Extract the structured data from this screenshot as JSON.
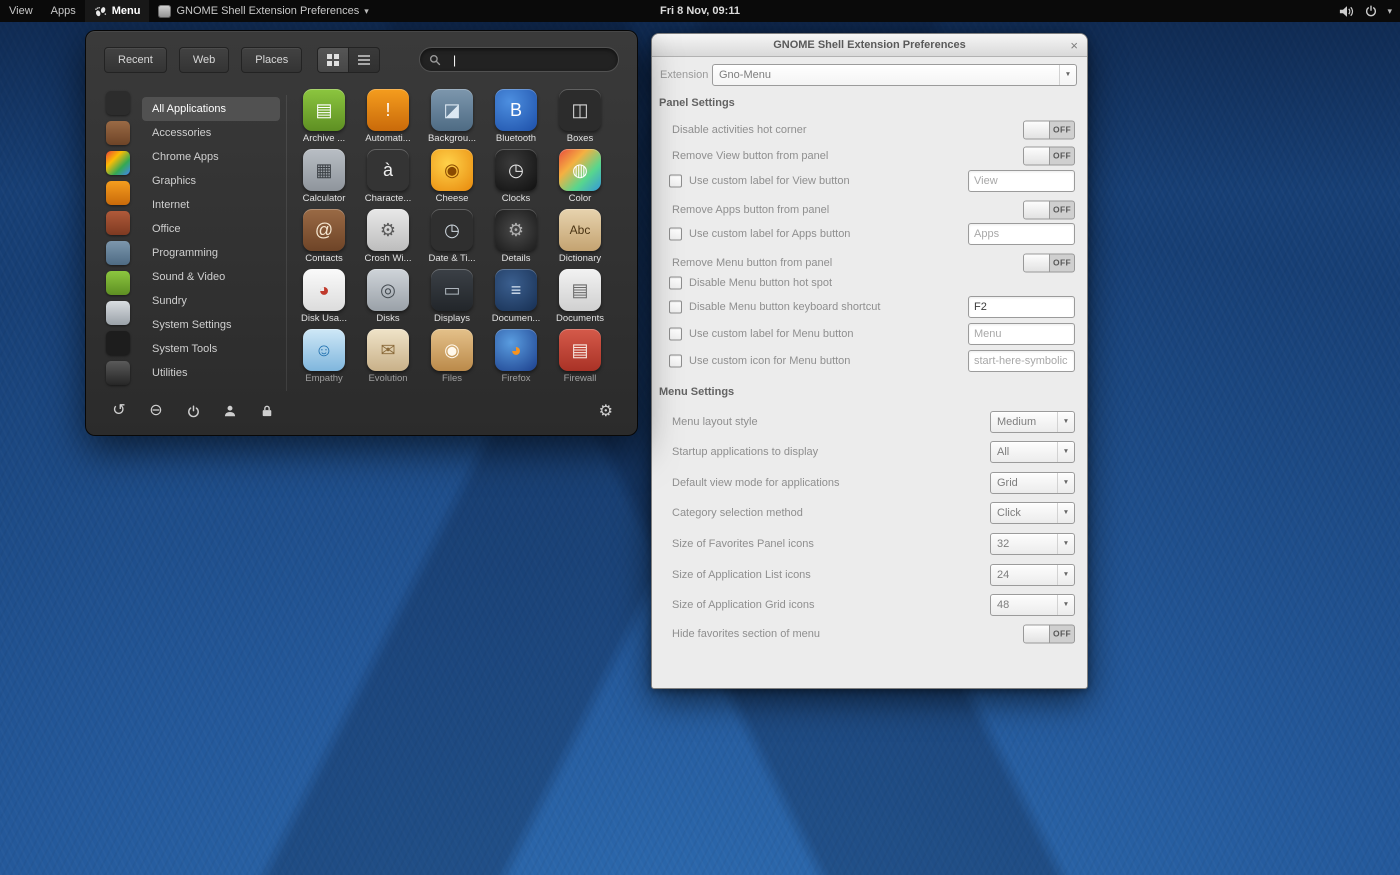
{
  "topbar": {
    "view_button": "View",
    "apps_button": "Apps",
    "menu_button": "Menu",
    "app_menu_label": "GNOME Shell Extension Preferences",
    "clock": "Fri 8 Nov, 09:11"
  },
  "icons": {
    "chevron_down": "▾",
    "combo_arrow": "▼",
    "close": "×",
    "gear": "⚙",
    "restart": "↺",
    "logout": "⊖",
    "caret": "|"
  },
  "menu": {
    "tabs": [
      "Recent",
      "Web",
      "Places"
    ],
    "search_value": "",
    "active_category": "All Applications",
    "categories": [
      "All Applications",
      "Accessories",
      "Chrome Apps",
      "Graphics",
      "Internet",
      "Office",
      "Programming",
      "Sound & Video",
      "Sundry",
      "System Settings",
      "System Tools",
      "Utilities"
    ],
    "favorites": [
      {
        "icon": "favorite-app-icon",
        "bg": "#2c2c2c"
      },
      {
        "icon": "favorite-app-icon",
        "bg": "linear-gradient(#9a6a45,#6e4427)"
      },
      {
        "icon": "favorite-app-icon",
        "bg": "linear-gradient(135deg,#ea4335,#fbbc05,#34a853,#4285f4)"
      },
      {
        "icon": "favorite-app-icon",
        "bg": "linear-gradient(#f59d1e,#c96a0a)"
      },
      {
        "icon": "favorite-app-icon",
        "bg": "linear-gradient(#b05a3a,#7e3a22)"
      },
      {
        "icon": "favorite-app-icon",
        "bg": "linear-gradient(#7d97ad,#4e6b84)"
      },
      {
        "icon": "favorite-app-icon",
        "bg": "linear-gradient(#8cc63f,#5e8f23)"
      },
      {
        "icon": "favorite-app-icon",
        "bg": "linear-gradient(#d9dde1,#9aa1a8)"
      },
      {
        "icon": "favorite-app-icon",
        "bg": "#1d1d1d"
      },
      {
        "icon": "favorite-app-icon",
        "bg": "linear-gradient(#5a5a5a,#262626)"
      }
    ],
    "apps": [
      {
        "label": "Archive ...",
        "icon": "archive-manager-icon",
        "bg": "linear-gradient(#8cc63f,#5e8f23)",
        "fg": "#ffffff",
        "glyph": "▤"
      },
      {
        "label": "Automati...",
        "icon": "automation-icon",
        "bg": "linear-gradient(#f59d1e,#c96a0a)",
        "fg": "#ffffff",
        "glyph": "!"
      },
      {
        "label": "Backgrou...",
        "icon": "backgrounds-icon",
        "bg": "linear-gradient(#7d97ad,#4e6b84)",
        "fg": "#dce8f2",
        "glyph": "◪"
      },
      {
        "label": "Bluetooth",
        "icon": "bluetooth-icon",
        "bg": "radial-gradient(circle at 35% 30%, #4d8fe0, #1d4fa8)",
        "fg": "#ffffff",
        "glyph": "B"
      },
      {
        "label": "Boxes",
        "icon": "boxes-icon",
        "bg": "#2c2c2c",
        "fg": "#d8d8d8",
        "glyph": "◫"
      },
      {
        "label": "Calculator",
        "icon": "calculator-icon",
        "bg": "linear-gradient(#b9bec4,#8f959c)",
        "fg": "#3a3f44",
        "glyph": "▦"
      },
      {
        "label": "Characte...",
        "icon": "character-map-icon",
        "bg": "#343434",
        "fg": "#f0f0f0",
        "glyph": "à"
      },
      {
        "label": "Cheese",
        "icon": "cheese-icon",
        "bg": "radial-gradient(circle at 40% 35%, #ffd24a, #e8890c)",
        "fg": "#8a4a00",
        "glyph": "◉"
      },
      {
        "label": "Clocks",
        "icon": "clocks-icon",
        "bg": "radial-gradient(circle at 40% 35%, #3a3a3a, #101010)",
        "fg": "#e8e8e8",
        "glyph": "◷"
      },
      {
        "label": "Color",
        "icon": "color-icon",
        "bg": "linear-gradient(135deg,#e84c3d,#f5b041,#58d68d,#3498db)",
        "fg": "#ffffff",
        "glyph": "◍"
      },
      {
        "label": "Contacts",
        "icon": "contacts-icon",
        "bg": "linear-gradient(#9a6a45,#6e4427)",
        "fg": "#f5e6d0",
        "glyph": "@"
      },
      {
        "label": "Crosh Wi...",
        "icon": "crosh-window-icon",
        "bg": "linear-gradient(#e8e8e8,#bdbdbd)",
        "fg": "#5a5a5a",
        "glyph": "⚙"
      },
      {
        "label": "Date & Ti...",
        "icon": "date-time-icon",
        "bg": "#2f2f2f",
        "fg": "#cfd8e0",
        "glyph": "◷"
      },
      {
        "label": "Details",
        "icon": "details-icon",
        "bg": "radial-gradient(circle, #4a4a4a, #1c1c1c)",
        "fg": "#b0b0b0",
        "glyph": "⚙"
      },
      {
        "label": "Dictionary",
        "icon": "dictionary-icon",
        "bg": "linear-gradient(#e7d3ae,#c4a371)",
        "fg": "#4a3414",
        "glyph": "Abc"
      },
      {
        "label": "Disk Usa...",
        "icon": "disk-usage-icon",
        "bg": "linear-gradient(#fafafa,#dcdcdc)",
        "fg": "#c0392b",
        "glyph": "◕"
      },
      {
        "label": "Disks",
        "icon": "disks-icon",
        "bg": "linear-gradient(#cfd4d9,#9aa1a8)",
        "fg": "#454c52",
        "glyph": "◎"
      },
      {
        "label": "Displays",
        "icon": "displays-icon",
        "bg": "linear-gradient(#3b4046,#22262a)",
        "fg": "#aeb6bd",
        "glyph": "▭"
      },
      {
        "label": "Documen...",
        "icon": "document-viewer-icon",
        "bg": "radial-gradient(circle at 40% 35%, #3b5f8f, #172f52)",
        "fg": "#d5e2f0",
        "glyph": "≡"
      },
      {
        "label": "Documents",
        "icon": "documents-icon",
        "bg": "linear-gradient(#f2f2f2,#d0d0d0)",
        "fg": "#6a6a6a",
        "glyph": "▤"
      },
      {
        "label": "Empathy",
        "icon": "empathy-icon",
        "bg": "linear-gradient(#cfe8f7,#7fb6dd)",
        "fg": "#1f6fae",
        "glyph": "☺"
      },
      {
        "label": "Evolution",
        "icon": "evolution-icon",
        "bg": "linear-gradient(#efe3c8,#c9b189)",
        "fg": "#8a6a3a",
        "glyph": "✉"
      },
      {
        "label": "Files",
        "icon": "files-icon",
        "bg": "linear-gradient(#e4c18a,#bb8a4a)",
        "fg": "#fff8ec",
        "glyph": "◉"
      },
      {
        "label": "Firefox",
        "icon": "firefox-icon",
        "bg": "radial-gradient(circle at 38% 32%, #5a9de0, #1c3f8c)",
        "fg": "#f7931e",
        "glyph": "◕"
      },
      {
        "label": "Firewall",
        "icon": "firewall-icon",
        "bg": "linear-gradient(#d55a4a,#a93226)",
        "fg": "#f8e8e0",
        "glyph": "▤"
      }
    ]
  },
  "prefs": {
    "title": "GNOME Shell Extension Preferences",
    "extension_label": "Extension",
    "extension_value": "Gno-Menu",
    "sections": {
      "panel": "Panel Settings",
      "menu": "Menu Settings"
    },
    "panel_rows": [
      {
        "type": "switch",
        "label": "Disable activities hot corner",
        "value": "OFF"
      },
      {
        "type": "switch",
        "label": "Remove View button from panel",
        "value": "OFF"
      },
      {
        "type": "check_entry",
        "label": "Use custom label for View button",
        "checked": false,
        "entry": "View",
        "entry_state": "placeholder"
      },
      {
        "type": "switch",
        "label": "Remove Apps button from panel",
        "value": "OFF"
      },
      {
        "type": "check_entry",
        "label": "Use custom label for Apps button",
        "checked": false,
        "entry": "Apps",
        "entry_state": "placeholder"
      },
      {
        "type": "switch",
        "label": "Remove Menu button from panel",
        "value": "OFF"
      },
      {
        "type": "check",
        "label": "Disable Menu button hot spot",
        "checked": false
      },
      {
        "type": "check_entry",
        "label": "Disable Menu button keyboard shortcut",
        "checked": false,
        "entry": "F2",
        "entry_state": "value"
      },
      {
        "type": "check_entry",
        "label": "Use custom label for Menu button",
        "checked": false,
        "entry": "Menu",
        "entry_state": "placeholder"
      },
      {
        "type": "check_entry",
        "label": "Use custom icon for Menu button",
        "checked": false,
        "entry": "start-here-symbolic",
        "entry_state": "placeholder"
      }
    ],
    "menu_rows": [
      {
        "type": "combo",
        "label": "Menu layout style",
        "value": "Medium"
      },
      {
        "type": "combo",
        "label": "Startup applications to display",
        "value": "All"
      },
      {
        "type": "combo",
        "label": "Default view mode for applications",
        "value": "Grid"
      },
      {
        "type": "combo",
        "label": "Category selection method",
        "value": "Click"
      },
      {
        "type": "combo",
        "label": "Size of Favorites Panel icons",
        "value": "32"
      },
      {
        "type": "combo",
        "label": "Size of Application List icons",
        "value": "24"
      },
      {
        "type": "combo",
        "label": "Size of Application Grid icons",
        "value": "48"
      },
      {
        "type": "switch",
        "label": "Hide favorites section of menu",
        "value": "OFF"
      }
    ]
  }
}
